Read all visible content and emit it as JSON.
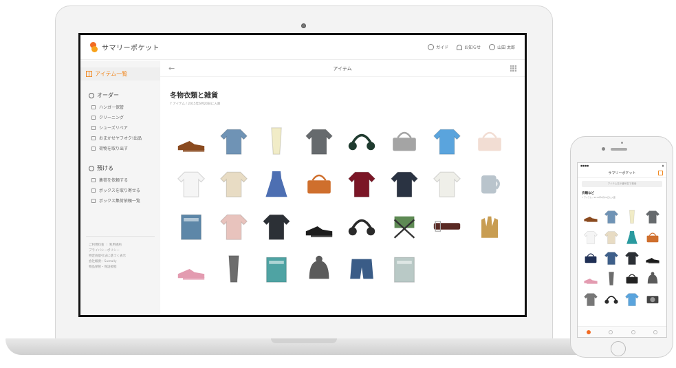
{
  "header": {
    "logo_text": "サマリーポケット",
    "guide": "ガイド",
    "notifications": "お知らせ",
    "user": "山田 太郎"
  },
  "sidebar": {
    "active_item": "アイテム一覧",
    "order_section": "オーダー",
    "order_items": [
      "ハンガー保管",
      "クリーニング",
      "シューズリペア",
      "おまかせヤフオク!出品",
      "荷物を取り出す"
    ],
    "deposit_section": "預ける",
    "deposit_items": [
      "集荷を依頼する",
      "ボックスを取り寄せる",
      "ボックス集荷依頼一覧"
    ],
    "footer_links": [
      "ご利用料金 ｜ 利用規約",
      "プライバシーポリシー",
      "特定商取引法に基づく表示",
      "会社概要：Sumally",
      "物品保管・保証規程"
    ]
  },
  "main": {
    "topbar_title": "アイテム",
    "page_title": "冬物衣類と雑貨",
    "page_subtitle": "7 アイテム / 2015年6月20日に入庫",
    "items": [
      {
        "name": "brown-shoes",
        "color": "#8a4a1f"
      },
      {
        "name": "blue-jacket",
        "color": "#6f93b5"
      },
      {
        "name": "cream-scarf",
        "color": "#f1ecc7"
      },
      {
        "name": "grey-coat",
        "color": "#666a6d"
      },
      {
        "name": "headphones",
        "color": "#1f3b2f"
      },
      {
        "name": "grey-bag",
        "color": "#a4a4a4"
      },
      {
        "name": "blue-shirt",
        "color": "#5aa4dd"
      },
      {
        "name": "pink-wallet",
        "color": "#f2ddd3"
      },
      {
        "name": "sailor-top",
        "color": "#f5f5f5"
      },
      {
        "name": "cream-jacket",
        "color": "#e8dcc4"
      },
      {
        "name": "blue-dress",
        "color": "#4d6fb2"
      },
      {
        "name": "orange-bag",
        "color": "#cf6f2d"
      },
      {
        "name": "red-vest",
        "color": "#7b1626"
      },
      {
        "name": "denim-jacket",
        "color": "#2a3342"
      },
      {
        "name": "white-sweater",
        "color": "#efefe9"
      },
      {
        "name": "mug",
        "color": "#b9c4cc"
      },
      {
        "name": "photo-album",
        "color": "#5d87a8"
      },
      {
        "name": "pink-jacket",
        "color": "#e8c3bd"
      },
      {
        "name": "black-tshirt",
        "color": "#2c3036"
      },
      {
        "name": "black-boots",
        "color": "#1d1d1d"
      },
      {
        "name": "earphones",
        "color": "#2a2a2a"
      },
      {
        "name": "camp-chair",
        "color": "#5e8a54"
      },
      {
        "name": "belt",
        "color": "#5a2a24"
      },
      {
        "name": "gloves",
        "color": "#c89d52"
      },
      {
        "name": "floral-heels",
        "color": "#e39bb0"
      },
      {
        "name": "grey-tie",
        "color": "#6d6d6d"
      },
      {
        "name": "book",
        "color": "#4fa3a3"
      },
      {
        "name": "knit-hat",
        "color": "#5b5b5b"
      },
      {
        "name": "denim-shorts",
        "color": "#3a5c87"
      },
      {
        "name": "magazine",
        "color": "#b9c9c6"
      }
    ]
  },
  "phone": {
    "title": "サマリーポケット",
    "search_placeholder": "アイテム名や番号名で検索",
    "section_title": "衣類など",
    "section_sub": "7 アイテム / 2015年6月20日に入庫",
    "items": [
      {
        "name": "brown-shoes",
        "color": "#8a4a1f"
      },
      {
        "name": "blue-jacket",
        "color": "#6f93b5"
      },
      {
        "name": "cream-scarf",
        "color": "#f1ecc7"
      },
      {
        "name": "grey-coat",
        "color": "#666a6d"
      },
      {
        "name": "sailor-top",
        "color": "#f5f5f5"
      },
      {
        "name": "cream-jacket",
        "color": "#e8dcc4"
      },
      {
        "name": "blue-dress",
        "color": "#2a9a9f"
      },
      {
        "name": "orange-bag",
        "color": "#cf6f2d"
      },
      {
        "name": "navy-bag",
        "color": "#1f2f55"
      },
      {
        "name": "denim-jacket",
        "color": "#3e5f8a"
      },
      {
        "name": "black-tshirt",
        "color": "#2c3036"
      },
      {
        "name": "black-boots",
        "color": "#1d1d1d"
      },
      {
        "name": "floral-heels",
        "color": "#e39bb0"
      },
      {
        "name": "grey-tie",
        "color": "#6d6d6d"
      },
      {
        "name": "black-wallet",
        "color": "#222222"
      },
      {
        "name": "knit-hat",
        "color": "#5b5b5b"
      },
      {
        "name": "grey-sweater",
        "color": "#777777"
      },
      {
        "name": "earphones",
        "color": "#2a2a2a"
      },
      {
        "name": "blue-shirt",
        "color": "#5aa4dd"
      },
      {
        "name": "camera",
        "color": "#444444"
      }
    ]
  }
}
